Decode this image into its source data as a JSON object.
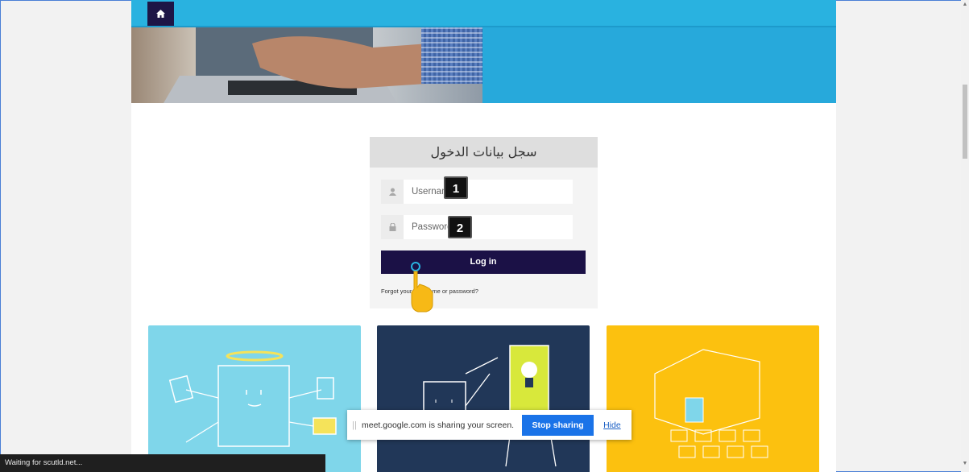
{
  "nav": {
    "home_icon": "home-icon"
  },
  "login": {
    "heading": "سجل بيانات الدخول",
    "username_placeholder": "Username",
    "password_placeholder": "Password",
    "user_icon": "user-icon",
    "lock_icon": "lock-icon",
    "button_label": "Log in",
    "forgot_link": "Forgot your username or password?"
  },
  "annotations": {
    "step1": "1",
    "step2": "2"
  },
  "cards": [
    {
      "color": "#7fd6ea"
    },
    {
      "color": "#213758"
    },
    {
      "color": "#fcc10f"
    }
  ],
  "share_bar": {
    "message": "meet.google.com is sharing your screen.",
    "stop_label": "Stop sharing",
    "hide_label": "Hide"
  },
  "status_bar": {
    "text": "Waiting for scutld.net..."
  },
  "colors": {
    "accent": "#29b2e0",
    "dark_button": "#1b1146",
    "share_blue": "#1a73e8"
  }
}
